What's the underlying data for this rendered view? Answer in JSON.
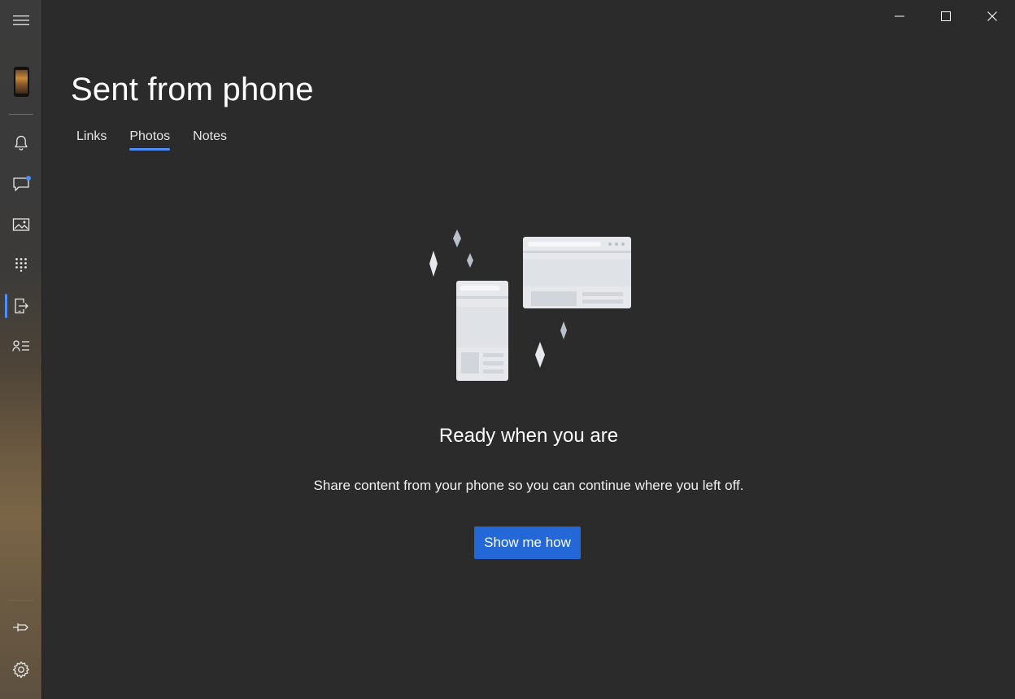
{
  "page": {
    "title": "Sent from phone",
    "tabs": [
      {
        "label": "Links",
        "active": false
      },
      {
        "label": "Photos",
        "active": true
      },
      {
        "label": "Notes",
        "active": false
      }
    ]
  },
  "empty_state": {
    "title": "Ready when you are",
    "description": "Share content from your phone so you can continue where you left off.",
    "button_label": "Show me how"
  },
  "sidebar": {
    "items": [
      {
        "icon": "hamburger-menu-icon"
      },
      {
        "icon": "phone-wallpaper-thumbnail"
      },
      {
        "icon": "bell-icon"
      },
      {
        "icon": "chat-bubble-icon",
        "badge": true
      },
      {
        "icon": "photos-icon"
      },
      {
        "icon": "dialpad-icon"
      },
      {
        "icon": "phone-share-icon",
        "active": true
      },
      {
        "icon": "contacts-list-icon"
      },
      {
        "icon": "pin-icon"
      },
      {
        "icon": "gear-icon"
      }
    ]
  },
  "window_controls": [
    "minimize-icon",
    "maximize-icon",
    "close-icon"
  ],
  "colors": {
    "background": "#2b2b2b",
    "accent": "#4f8ef7",
    "button": "#2467d6",
    "text": "#ffffff"
  }
}
